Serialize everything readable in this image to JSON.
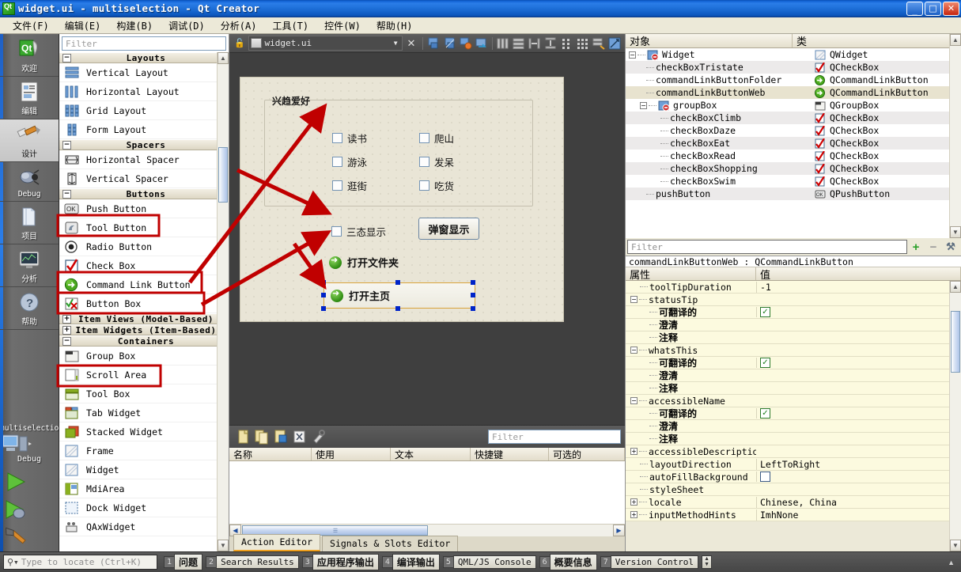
{
  "window": {
    "title": "widget.ui - multiselection - Qt Creator",
    "app_icon": "qt-logo-icon",
    "minimize": "–",
    "maximize": "❐",
    "close": "✕"
  },
  "menubar": [
    {
      "label": "文件(F)"
    },
    {
      "label": "编辑(E)"
    },
    {
      "label": "构建(B)"
    },
    {
      "label": "调试(D)"
    },
    {
      "label": "分析(A)"
    },
    {
      "label": "工具(T)"
    },
    {
      "label": "控件(W)"
    },
    {
      "label": "帮助(H)"
    }
  ],
  "modebar": {
    "modes": [
      {
        "label": "欢迎",
        "icon": "qt-welcome-icon",
        "glyph": "Qt",
        "active": false
      },
      {
        "label": "编辑",
        "icon": "edit-document-icon",
        "glyph": "☰",
        "active": false
      },
      {
        "label": "设计",
        "icon": "design-brush-icon",
        "glyph": "✐",
        "active": true
      },
      {
        "label": "Debug",
        "icon": "debug-bug-icon",
        "glyph": "●",
        "active": false
      },
      {
        "label": "项目",
        "icon": "projects-folder-icon",
        "glyph": "◫",
        "active": false
      },
      {
        "label": "分析",
        "icon": "analyze-monitor-icon",
        "glyph": "▣",
        "active": false
      },
      {
        "label": "帮助",
        "icon": "help-question-icon",
        "glyph": "?",
        "active": false
      }
    ],
    "kit": {
      "project": "multiselection",
      "build": "Debug",
      "icon": "kit-computer-icon"
    },
    "run_buttons": [
      {
        "name": "run-button",
        "glyph": "▶"
      },
      {
        "name": "debug-run-button",
        "glyph": "▶"
      },
      {
        "name": "build-button",
        "glyph": "⚒"
      }
    ]
  },
  "widget_box": {
    "filter_placeholder": "Filter",
    "groups": [
      {
        "title": "Layouts",
        "expanded": true,
        "items": [
          {
            "label": "Vertical Layout",
            "icon": "vertical-layout-icon"
          },
          {
            "label": "Horizontal Layout",
            "icon": "horizontal-layout-icon"
          },
          {
            "label": "Grid Layout",
            "icon": "grid-layout-icon"
          },
          {
            "label": "Form Layout",
            "icon": "form-layout-icon"
          }
        ]
      },
      {
        "title": "Spacers",
        "expanded": true,
        "items": [
          {
            "label": "Horizontal Spacer",
            "icon": "horizontal-spacer-icon"
          },
          {
            "label": "Vertical Spacer",
            "icon": "vertical-spacer-icon"
          }
        ]
      },
      {
        "title": "Buttons",
        "expanded": true,
        "items": [
          {
            "label": "Push Button",
            "icon": "push-button-icon",
            "highlighted": true
          },
          {
            "label": "Tool Button",
            "icon": "tool-button-icon"
          },
          {
            "label": "Radio Button",
            "icon": "radio-button-icon"
          },
          {
            "label": "Check Box",
            "icon": "check-box-icon",
            "highlighted": true
          },
          {
            "label": "Command Link Button",
            "icon": "command-link-button-icon",
            "highlighted": true
          },
          {
            "label": "Button Box",
            "icon": "button-box-icon"
          }
        ]
      },
      {
        "title": "Item Views (Model-Based)",
        "expanded": false,
        "items": []
      },
      {
        "title": "Item Widgets (Item-Based)",
        "expanded": false,
        "items": []
      },
      {
        "title": "Containers",
        "expanded": true,
        "items": [
          {
            "label": "Group Box",
            "icon": "group-box-icon",
            "highlighted": true
          },
          {
            "label": "Scroll Area",
            "icon": "scroll-area-icon"
          },
          {
            "label": "Tool Box",
            "icon": "tool-box-icon"
          },
          {
            "label": "Tab Widget",
            "icon": "tab-widget-icon"
          },
          {
            "label": "Stacked Widget",
            "icon": "stacked-widget-icon"
          },
          {
            "label": "Frame",
            "icon": "frame-icon"
          },
          {
            "label": "Widget",
            "icon": "widget-icon"
          },
          {
            "label": "MdiArea",
            "icon": "mdi-area-icon"
          },
          {
            "label": "Dock Widget",
            "icon": "dock-widget-icon"
          },
          {
            "label": "QAxWidget",
            "icon": "qax-widget-icon"
          }
        ]
      }
    ]
  },
  "designer_toolbar": {
    "lock_icon": "unlocked-padlock-icon",
    "file_icon": "ui-file-icon",
    "file_name": "widget.ui",
    "dropdown_glyph": "▼",
    "close_glyph": "✕",
    "tools": [
      {
        "name": "edit-widgets-tool",
        "glyph": "◱"
      },
      {
        "name": "edit-signals-slots-tool",
        "glyph": "◰"
      },
      {
        "name": "edit-buddies-tool",
        "glyph": "◳"
      },
      {
        "name": "edit-tab-order-tool",
        "glyph": "◲"
      },
      {
        "name": "layout-horizontally-tool",
        "glyph": "⫴"
      },
      {
        "name": "layout-vertically-tool",
        "glyph": "≡"
      },
      {
        "name": "layout-splitter-horizontal-tool",
        "glyph": "↦"
      },
      {
        "name": "layout-splitter-vertical-tool",
        "glyph": "⤓"
      },
      {
        "name": "layout-form-tool",
        "glyph": "∷"
      },
      {
        "name": "layout-grid-tool",
        "glyph": "∷"
      },
      {
        "name": "break-layout-tool",
        "glyph": "⤧"
      },
      {
        "name": "adjust-size-tool",
        "glyph": "⤡"
      }
    ]
  },
  "form": {
    "group_box": {
      "title": "兴趋爱好"
    },
    "checkboxes_left": [
      {
        "label": "读书"
      },
      {
        "label": "游泳"
      },
      {
        "label": "逛街"
      }
    ],
    "checkboxes_right": [
      {
        "label": "爬山"
      },
      {
        "label": "发呆"
      },
      {
        "label": "吃货"
      }
    ],
    "tristate_checkbox": {
      "label": "三态显示"
    },
    "push_button": {
      "label": "弹窗显示"
    },
    "command_links": [
      {
        "label": "打开文件夹",
        "selected": false,
        "icon": "green-arrow-icon"
      },
      {
        "label": "打开主页",
        "selected": true,
        "icon": "green-arrow-icon"
      }
    ]
  },
  "object_inspector": {
    "columns": [
      "对象",
      "类"
    ],
    "rows": [
      {
        "name": "Widget",
        "cls": "QWidget",
        "depth": 0,
        "expander": "-",
        "icon": "widget-layout-icon",
        "selected": false
      },
      {
        "name": "checkBoxTristate",
        "cls": "QCheckBox",
        "depth": 1,
        "icon": "check-box-icon",
        "selected": false
      },
      {
        "name": "commandLinkButtonFolder",
        "cls": "QCommandLinkButton",
        "depth": 1,
        "icon": "command-link-button-icon",
        "selected": false
      },
      {
        "name": "commandLinkButtonWeb",
        "cls": "QCommandLinkButton",
        "depth": 1,
        "icon": "command-link-button-icon",
        "selected": true
      },
      {
        "name": "groupBox",
        "cls": "QGroupBox",
        "depth": 1,
        "expander": "-",
        "icon": "group-box-icon",
        "selected": false
      },
      {
        "name": "checkBoxClimb",
        "cls": "QCheckBox",
        "depth": 2,
        "icon": "check-box-icon",
        "selected": false
      },
      {
        "name": "checkBoxDaze",
        "cls": "QCheckBox",
        "depth": 2,
        "icon": "check-box-icon",
        "selected": false
      },
      {
        "name": "checkBoxEat",
        "cls": "QCheckBox",
        "depth": 2,
        "icon": "check-box-icon",
        "selected": false
      },
      {
        "name": "checkBoxRead",
        "cls": "QCheckBox",
        "depth": 2,
        "icon": "check-box-icon",
        "selected": false
      },
      {
        "name": "checkBoxShopping",
        "cls": "QCheckBox",
        "depth": 2,
        "icon": "check-box-icon",
        "selected": false
      },
      {
        "name": "checkBoxSwim",
        "cls": "QCheckBox",
        "depth": 2,
        "icon": "check-box-icon",
        "selected": false
      },
      {
        "name": "pushButton",
        "cls": "QPushButton",
        "depth": 1,
        "icon": "push-button-icon",
        "selected": false
      }
    ]
  },
  "property_editor": {
    "filter_placeholder": "Filter",
    "add_glyph": "+",
    "remove_glyph": "−",
    "config_glyph": "⚒",
    "object_line": "commandLinkButtonWeb : QCommandLinkButton",
    "columns": [
      "属性",
      "值"
    ],
    "rows": [
      {
        "name": "toolTipDuration",
        "value": "-1",
        "depth": 1,
        "kind": "text"
      },
      {
        "name": "statusTip",
        "value": "",
        "depth": 0,
        "expander": "-",
        "kind": "text"
      },
      {
        "name": "可翻译的",
        "value": "",
        "depth": 2,
        "kind": "check-on",
        "cjk": true
      },
      {
        "name": "澄清",
        "value": "",
        "depth": 2,
        "kind": "text",
        "cjk": true
      },
      {
        "name": "注释",
        "value": "",
        "depth": 2,
        "kind": "text",
        "cjk": true
      },
      {
        "name": "whatsThis",
        "value": "",
        "depth": 0,
        "expander": "-",
        "kind": "text"
      },
      {
        "name": "可翻译的",
        "value": "",
        "depth": 2,
        "kind": "check-on",
        "cjk": true
      },
      {
        "name": "澄清",
        "value": "",
        "depth": 2,
        "kind": "text",
        "cjk": true
      },
      {
        "name": "注释",
        "value": "",
        "depth": 2,
        "kind": "text",
        "cjk": true
      },
      {
        "name": "accessibleName",
        "value": "",
        "depth": 0,
        "expander": "-",
        "kind": "text"
      },
      {
        "name": "可翻译的",
        "value": "",
        "depth": 2,
        "kind": "check-on",
        "cjk": true
      },
      {
        "name": "澄清",
        "value": "",
        "depth": 2,
        "kind": "text",
        "cjk": true
      },
      {
        "name": "注释",
        "value": "",
        "depth": 2,
        "kind": "text",
        "cjk": true
      },
      {
        "name": "accessibleDescription",
        "value": "",
        "depth": 0,
        "expander": "+",
        "kind": "text"
      },
      {
        "name": "layoutDirection",
        "value": "LeftToRight",
        "depth": 1,
        "kind": "text"
      },
      {
        "name": "autoFillBackground",
        "value": "",
        "depth": 1,
        "kind": "check-off"
      },
      {
        "name": "styleSheet",
        "value": "",
        "depth": 1,
        "kind": "text"
      },
      {
        "name": "locale",
        "value": "Chinese, China",
        "depth": 0,
        "expander": "+",
        "kind": "text"
      },
      {
        "name": "inputMethodHints",
        "value": "ImhNone",
        "depth": 0,
        "expander": "+",
        "kind": "text"
      }
    ]
  },
  "action_editor": {
    "toolbar_icons": [
      {
        "name": "new-action-icon",
        "glyph": "▭"
      },
      {
        "name": "copy-action-icon",
        "glyph": "⧉"
      },
      {
        "name": "paste-action-icon",
        "glyph": "⎘"
      },
      {
        "name": "delete-action-icon",
        "glyph": "⌧"
      },
      {
        "name": "configure-action-icon",
        "glyph": "⚒"
      }
    ],
    "filter_placeholder": "Filter",
    "columns": [
      "名称",
      "使用",
      "文本",
      "快捷键",
      "可选的"
    ],
    "rows": [],
    "tabs": [
      {
        "label": "Action Editor",
        "active": true
      },
      {
        "label": "Signals & Slots Editor",
        "active": false
      }
    ]
  },
  "statusbar": {
    "locator_placeholder": "Type to locate (Ctrl+K)",
    "locator_icon": "search-magnifier-icon",
    "panes": [
      {
        "num": "1",
        "label": "问题",
        "cjk": true
      },
      {
        "num": "2",
        "label": "Search Results",
        "cjk": false
      },
      {
        "num": "3",
        "label": "应用程序输出",
        "cjk": true
      },
      {
        "num": "4",
        "label": "编译输出",
        "cjk": true
      },
      {
        "num": "5",
        "label": "QML/JS Console",
        "cjk": false
      },
      {
        "num": "6",
        "label": "概要信息",
        "cjk": true
      },
      {
        "num": "7",
        "label": "Version Control",
        "cjk": false
      }
    ],
    "collapse_glyph": "▲"
  },
  "annotations": {
    "color": "#c00000",
    "highlight_boxes": [
      "push-button-box",
      "check-box-box",
      "command-link-button-box",
      "group-box-box"
    ],
    "arrows": [
      "arrow-checkbox-up",
      "arrow-checkbox-down",
      "arrow-clb-up",
      "arrow-clb-down"
    ]
  }
}
